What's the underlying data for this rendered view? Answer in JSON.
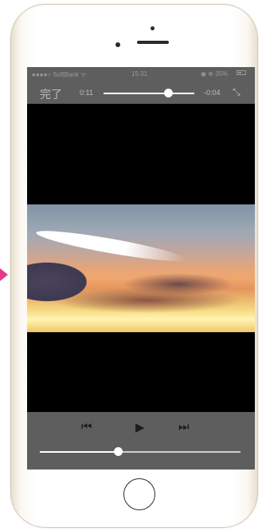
{
  "status_bar": {
    "carrier": "●●●●○ SoftBank ᯤ",
    "time": "15:31",
    "right": "◉ ⊕ 35%"
  },
  "player": {
    "done_label": "完了",
    "elapsed": "0:11",
    "remaining": "-0:04",
    "seek_progress": 0.73,
    "volume_level": 0.4
  },
  "icons": {
    "prev": "⏮",
    "play": "▶",
    "next": "⏭",
    "expand": "⤡"
  },
  "colors": {
    "bar_background": "#5e5e5e",
    "accent_marker": "#e23b8a"
  }
}
